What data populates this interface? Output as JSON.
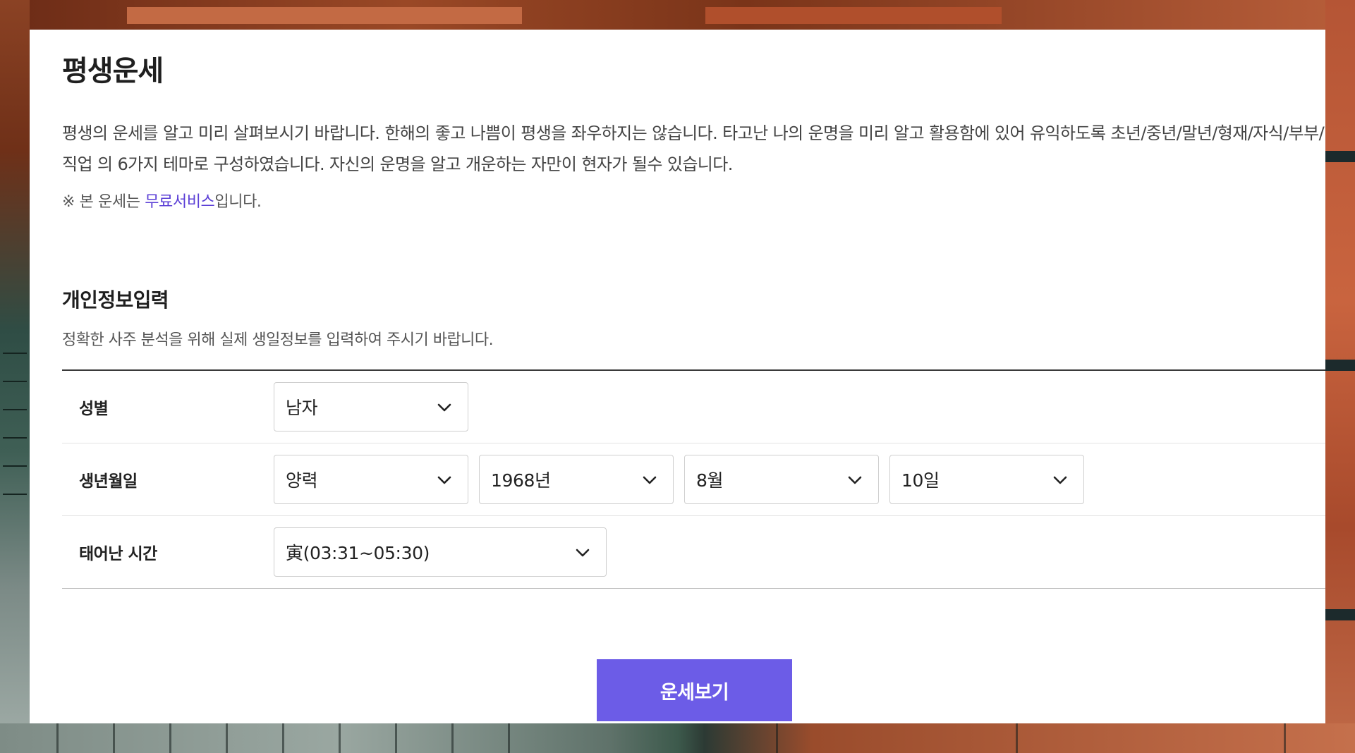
{
  "page": {
    "title": "평생운세",
    "description": "평생의 운세를 알고 미리 살펴보시기 바랍니다. 한해의 좋고 나쁨이 평생을 좌우하지는 않습니다. 타고난 나의 운명을 미리 알고 활용함에 있어 유익하도록 초년/중년/말년/형재/자식/부부/직업 의 6가지 테마로 구성하였습니다. 자신의 운명을 알고 개운하는 자만이 현자가 될수 있습니다.",
    "notice_prefix": "※ 본 운세는 ",
    "notice_link": "무료서비스",
    "notice_suffix": "입니다."
  },
  "section": {
    "title": "개인정보입력",
    "description": "정확한 사주 분석을 위해 실제 생일정보를 입력하여 주시기 바랍니다."
  },
  "form": {
    "gender": {
      "label": "성별",
      "value": "남자"
    },
    "birth": {
      "label": "생년월일",
      "calendar": "양력",
      "year": "1968년",
      "month": "8월",
      "day": "10일"
    },
    "time": {
      "label": "태어난 시간",
      "value": "寅(03:31~05:30)"
    }
  },
  "submit_label": "운세보기",
  "colors": {
    "accent": "#6c5ce7",
    "link": "#5b3fd6"
  },
  "icons": {
    "select_arrow": "chevron-down-icon"
  }
}
